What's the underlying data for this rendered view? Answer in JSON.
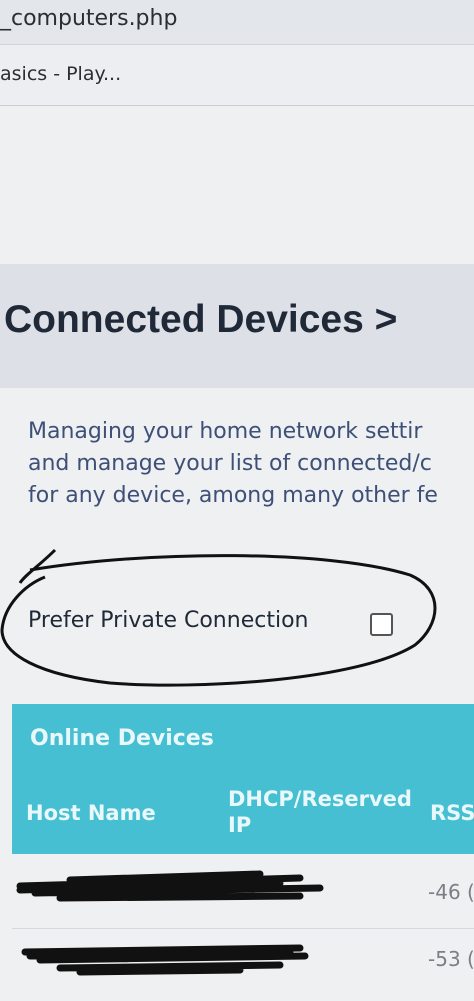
{
  "browser": {
    "url_fragment": "_computers.php",
    "tab_title": "asics - Play..."
  },
  "page": {
    "title": "Connected Devices >",
    "description_lines": [
      "Managing your home network settir",
      "and manage your list of connected/c",
      "for any device, among many other fe"
    ],
    "prefer_private_label": "Prefer Private Connection",
    "prefer_private_checked": false
  },
  "online_devices": {
    "heading": "Online Devices",
    "columns": [
      "Host Name",
      "DHCP/Reserved IP",
      "RSS"
    ],
    "rows": [
      {
        "rss": "-46 ("
      },
      {
        "rss": "-53 ("
      }
    ]
  },
  "colors": {
    "table_header": "#46bfd2",
    "title_band": "#dde0e6",
    "description_text": "#3e5078",
    "annotation_ink": "#111111"
  }
}
